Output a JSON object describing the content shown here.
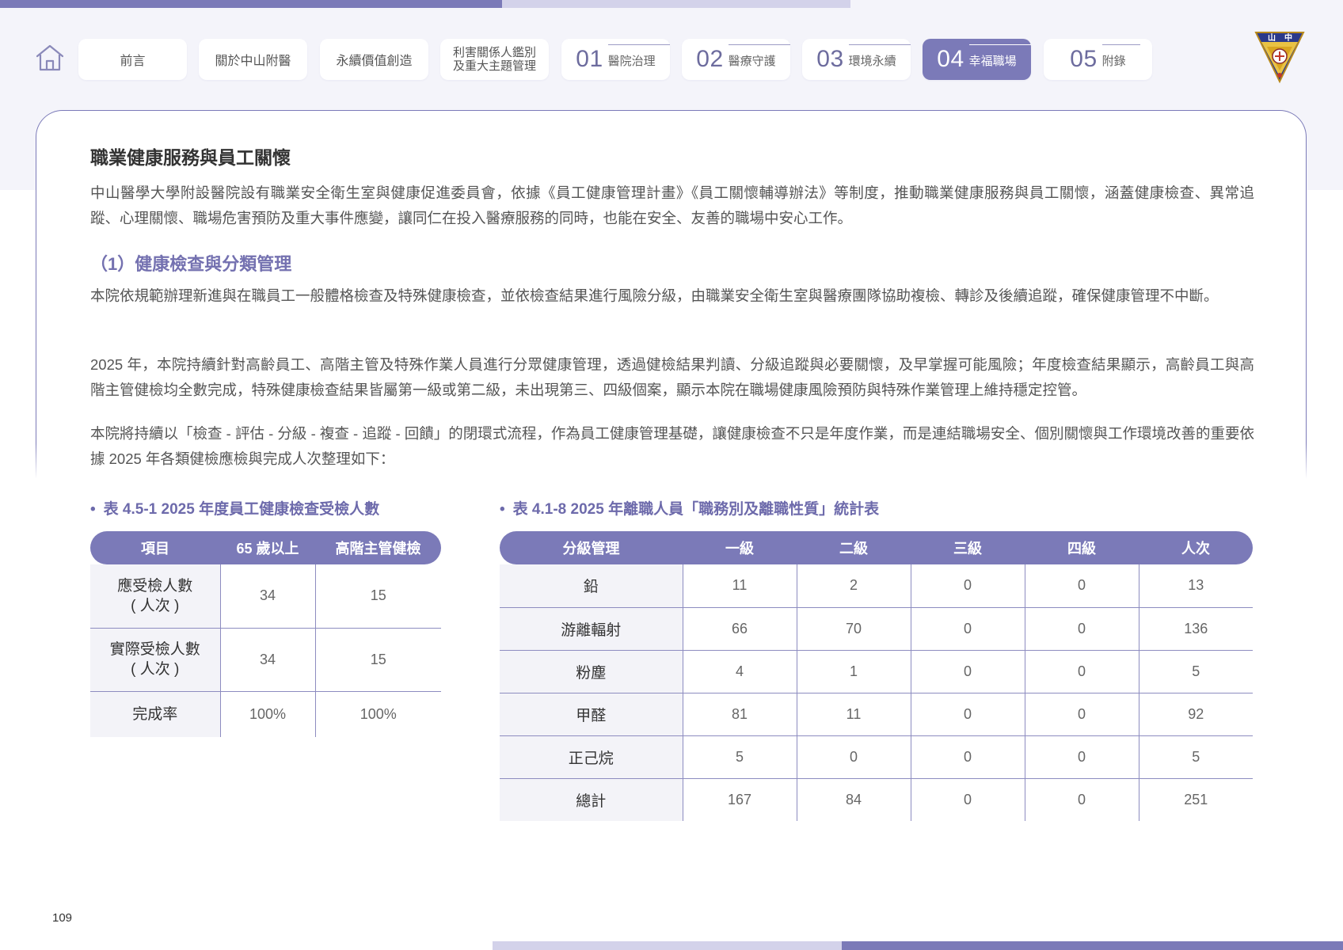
{
  "nav": {
    "tabs": [
      {
        "label": "前言"
      },
      {
        "label": "關於中山附醫"
      },
      {
        "label": "永續價值創造"
      },
      {
        "line1": "利害關係人鑑別",
        "line2": "及重大主題管理"
      },
      {
        "num": "01",
        "label": "醫院治理"
      },
      {
        "num": "02",
        "label": "醫療守護"
      },
      {
        "num": "03",
        "label": "環境永續"
      },
      {
        "num": "04",
        "label": "幸福職場"
      },
      {
        "num": "05",
        "label": "附錄"
      }
    ],
    "logo_text": "山 中 醫"
  },
  "content": {
    "section_title": "職業健康服務與員工關懷",
    "intro": "中山醫學大學附設醫院設有職業安全衛生室與健康促進委員會，依據《員工健康管理計畫》《員工關懷輔導辦法》等制度，推動職業健康服務與員工關懷，涵蓋健康檢查、異常追蹤、心理關懷、職場危害預防及重大事件應變，讓同仁在投入醫療服務的同時，也能在安全、友善的職場中安心工作。",
    "sub_title": "（1）健康檢查與分類管理",
    "para1": "本院依規範辦理新進與在職員工一般體格檢查及特殊健康檢查，並依檢查結果進行風險分級，由職業安全衛生室與醫療團隊協助複檢、轉診及後續追蹤，確保健康管理不中斷。",
    "para2": "2025 年，本院持續針對高齡員工、高階主管及特殊作業人員進行分眾健康管理，透過健檢結果判讀、分級追蹤與必要關懷，及早掌握可能風險；年度檢查結果顯示，高齡員工與高階主管健檢均全數完成，特殊健康檢查結果皆屬第一級或第二級，未出現第三、四級個案，顯示本院在職場健康風險預防與特殊作業管理上維持穩定控管。",
    "para3": "本院將持續以「檢查 - 評估 - 分級 - 複查 - 追蹤 - 回饋」的閉環式流程，作為員工健康管理基礎，讓健康檢查不只是年度作業，而是連結職場安全、個別關懷與工作環境改善的重要依據 2025 年各類健檢應檢與完成人次整理如下："
  },
  "table1": {
    "caption": "表 4.5-1 2025 年度員工健康檢查受檢人數",
    "headers": [
      "項目",
      "65 歲以上",
      "高階主管健檢"
    ],
    "rows": [
      {
        "line1": "應受檢人數",
        "line2": "( 人次 )",
        "cells": [
          "34",
          "15"
        ]
      },
      {
        "line1": "實際受檢人數",
        "line2": "( 人次 )",
        "cells": [
          "34",
          "15"
        ]
      },
      {
        "label": "完成率",
        "cells": [
          "100%",
          "100%"
        ]
      }
    ]
  },
  "table2": {
    "caption": "表 4.1-8 2025 年離職人員「職務別及離職性質」統計表",
    "headers": [
      "分級管理",
      "一級",
      "二級",
      "三級",
      "四級",
      "人次"
    ],
    "rows": [
      {
        "label": "鉛",
        "cells": [
          "11",
          "2",
          "0",
          "0",
          "13"
        ]
      },
      {
        "label": "游離輻射",
        "cells": [
          "66",
          "70",
          "0",
          "0",
          "136"
        ]
      },
      {
        "label": "粉塵",
        "cells": [
          "4",
          "1",
          "0",
          "0",
          "5"
        ]
      },
      {
        "label": "甲醛",
        "cells": [
          "81",
          "11",
          "0",
          "0",
          "92"
        ]
      },
      {
        "label": "正己烷",
        "cells": [
          "5",
          "0",
          "0",
          "0",
          "5"
        ]
      },
      {
        "label": "總計",
        "cells": [
          "167",
          "84",
          "0",
          "0",
          "251"
        ]
      }
    ]
  },
  "page_number": "109",
  "colors": {
    "accent": "#7b7ab8",
    "accent_light": "#d3d2ea",
    "band": "#f4f4fa",
    "heading_purple": "#7471b0"
  },
  "icons": {
    "home": "home-icon",
    "logo": "hospital-emblem"
  }
}
